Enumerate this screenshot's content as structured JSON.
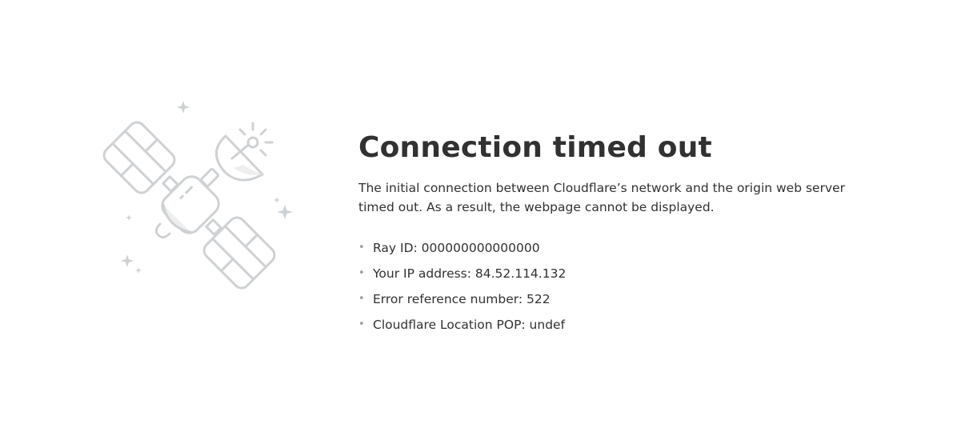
{
  "illustration": {
    "icon": "satellite-icon"
  },
  "error": {
    "title": "Connection timed out",
    "description": "The initial connection between Cloudflare’s network and the origin web server timed out. As a result, the webpage cannot be displayed.",
    "details": [
      {
        "text": "Ray ID: 000000000000000"
      },
      {
        "text": "Your IP address: 84.52.114.132"
      },
      {
        "text": "Error reference number: 522"
      },
      {
        "text": "Cloudflare Location POP: undef"
      }
    ]
  },
  "colors": {
    "text": "#313131",
    "illustration_stroke": "#cfd2d4",
    "illustration_fill": "#f6f6f6"
  }
}
